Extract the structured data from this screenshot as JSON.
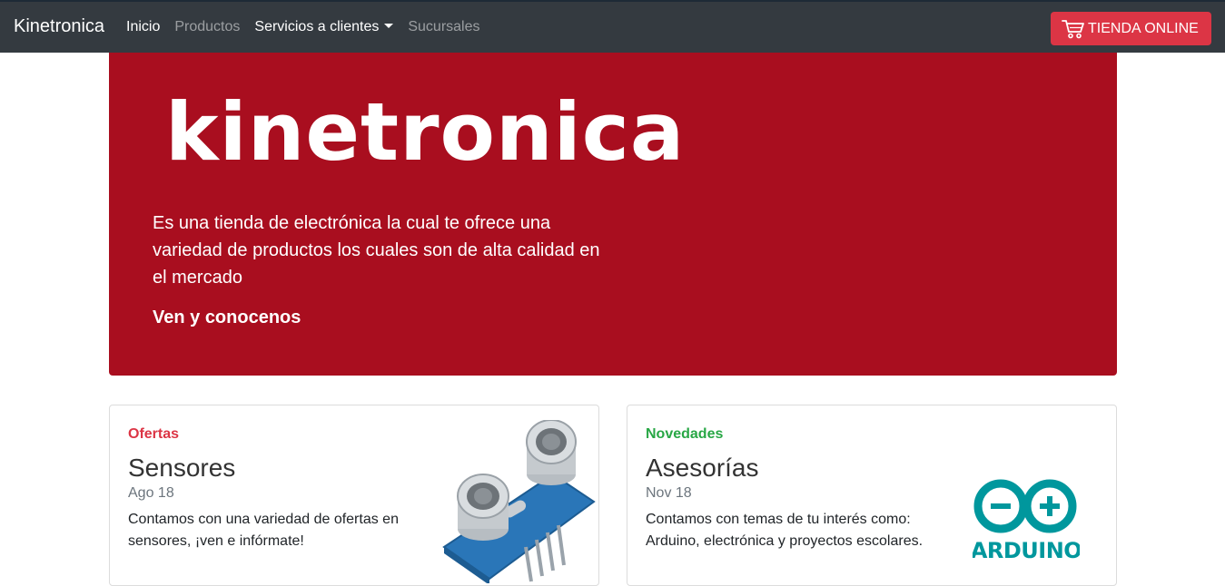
{
  "navbar": {
    "brand": "Kinetronica",
    "links": [
      {
        "label": "Inicio"
      },
      {
        "label": "Productos"
      },
      {
        "label": "Servicios a clientes"
      },
      {
        "label": "Sucursales"
      }
    ],
    "shop_button": "TIENDA ONLINE",
    "shop_icon": "cart-icon"
  },
  "jumbotron": {
    "logo_text": "kinetronica",
    "description": "Es una tienda de electrónica la cual te ofrece una variedad de productos los cuales son de alta calidad en el mercado",
    "cta": "Ven y conocenos",
    "bg_color": "#a90e1f"
  },
  "cards": [
    {
      "tag": "Ofertas",
      "title": "Sensores",
      "date": "Ago 18",
      "text": "Contamos con una variedad de ofertas en sensores, ¡ven e infórmate!",
      "image": "ultrasonic-sensor-image"
    },
    {
      "tag": "Novedades",
      "title": "Asesorías",
      "date": "Nov 18",
      "text": "Contamos con temas de tu interés como: Arduino, electrónica y proyectos escolares.",
      "image": "arduino-logo",
      "image_label": "ARDUINO"
    }
  ]
}
